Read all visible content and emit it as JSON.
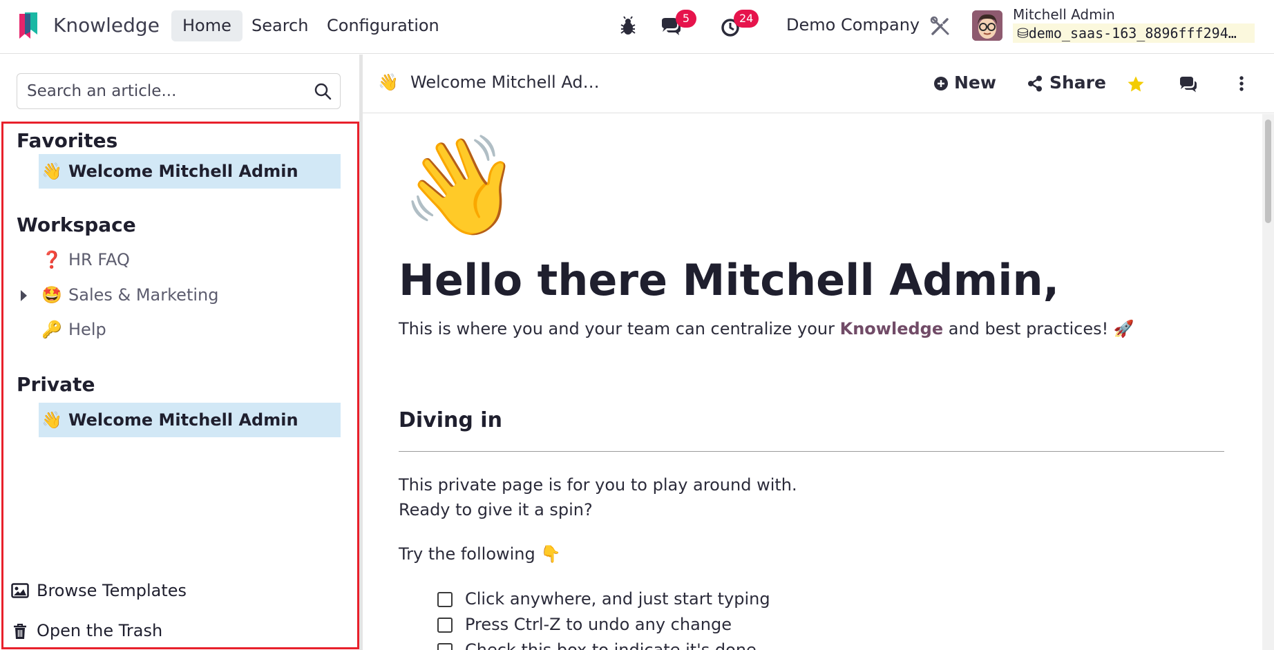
{
  "navbar": {
    "app_name": "Knowledge",
    "menu": [
      "Home",
      "Search",
      "Configuration"
    ],
    "messages_count": "5",
    "activities_count": "24",
    "company": "Demo Company",
    "user_name": "Mitchell Admin",
    "database": "demo_saas-163_8896fff294…"
  },
  "sidebar": {
    "search_placeholder": "Search an article...",
    "favorites": {
      "title": "Favorites",
      "items": [
        {
          "emoji": "👋",
          "label": "Welcome Mitchell Admin"
        }
      ]
    },
    "workspace": {
      "title": "Workspace",
      "items": [
        {
          "emoji": "❓",
          "label": "HR FAQ"
        },
        {
          "emoji": "🤩",
          "label": "Sales & Marketing"
        },
        {
          "emoji": "🔑",
          "label": "Help"
        }
      ]
    },
    "private": {
      "title": "Private",
      "items": [
        {
          "emoji": "👋",
          "label": "Welcome Mitchell Admin"
        }
      ]
    },
    "browse_templates": "Browse Templates",
    "open_trash": "Open the Trash"
  },
  "article_header": {
    "emoji": "👋",
    "title": "Welcome Mitchell Ad…",
    "new_label": "New",
    "share_label": "Share"
  },
  "article": {
    "cover_emoji": "👋",
    "heading": "Hello there Mitchell Admin,",
    "intro_before": "This is where you and your team can centralize your ",
    "intro_bold": "Knowledge",
    "intro_after": " and best practices! 🚀",
    "section_title": "Diving in",
    "para_1": "This private page is for you to play around with.",
    "para_2": "Ready to give it a spin?",
    "try_line": "Try the following 👇",
    "checklist": [
      "Click anywhere, and just start typing",
      "Press Ctrl-Z to undo any change",
      "Check this box to indicate it's done"
    ]
  },
  "colors": {
    "accent": "#714b67",
    "selected_bg": "#d2e8f6",
    "badge": "#e6144c",
    "highlight_border": "#e8202b",
    "star": "#f3cc00"
  }
}
